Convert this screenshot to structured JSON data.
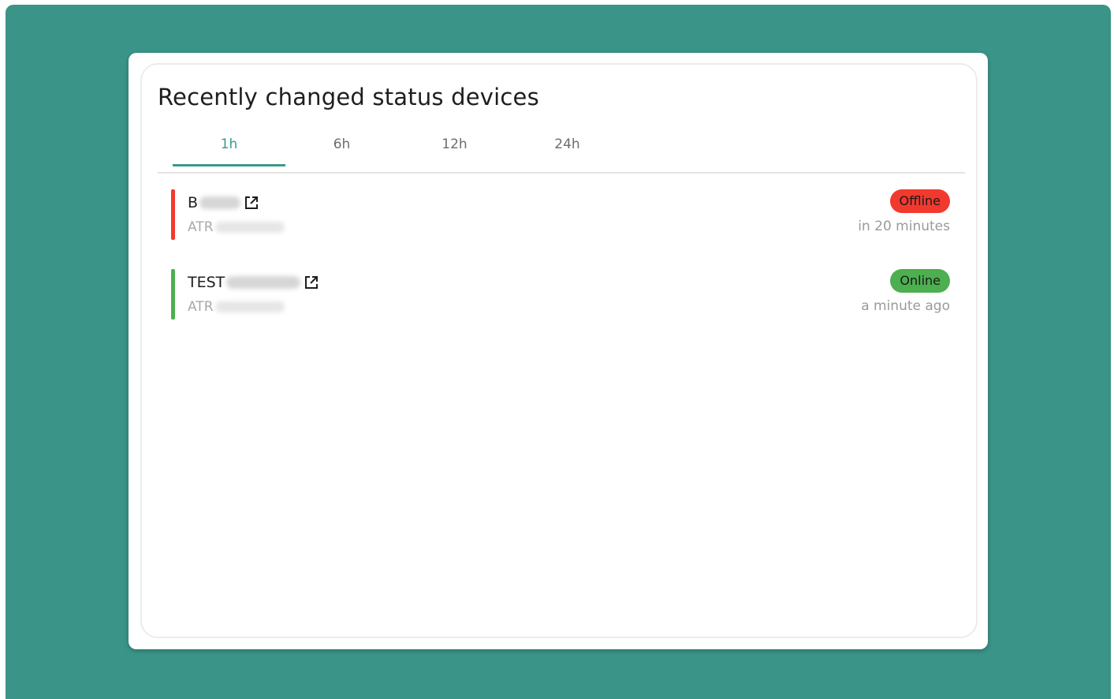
{
  "colors": {
    "background": "#3a9488",
    "accent": "#3a9a8c",
    "offline": "#f2392e",
    "online": "#4caf50"
  },
  "widget": {
    "title": "Recently changed status devices",
    "tabs": [
      {
        "label": "1h",
        "active": true
      },
      {
        "label": "6h",
        "active": false
      },
      {
        "label": "12h",
        "active": false
      },
      {
        "label": "24h",
        "active": false
      }
    ]
  },
  "devices": [
    {
      "name": "B",
      "serial": "ATR",
      "status": "Offline",
      "time": "in 20 minutes",
      "status_color": "#f2392e",
      "link_icon": "external-link-icon"
    },
    {
      "name": "TEST",
      "serial": "ATR",
      "status": "Online",
      "time": "a minute ago",
      "status_color": "#4caf50",
      "link_icon": "external-link-icon"
    }
  ]
}
